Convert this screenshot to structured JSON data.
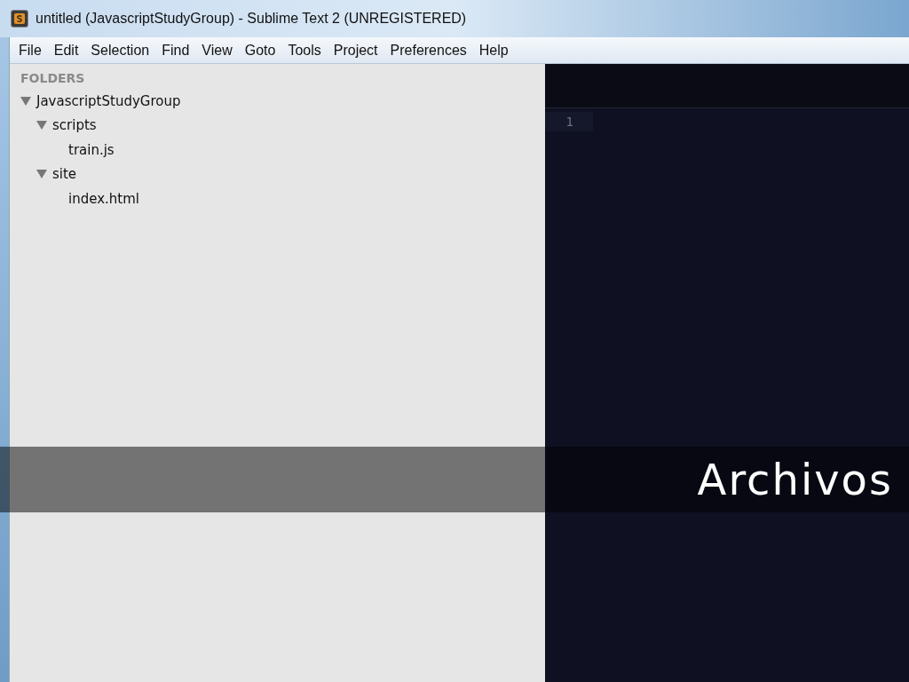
{
  "window": {
    "title": "untitled (JavascriptStudyGroup) - Sublime Text 2 (UNREGISTERED)"
  },
  "menu": [
    "File",
    "Edit",
    "Selection",
    "Find",
    "View",
    "Goto",
    "Tools",
    "Project",
    "Preferences",
    "Help"
  ],
  "sidebar": {
    "heading": "FOLDERS",
    "tree": [
      {
        "label": "JavascriptStudyGroup",
        "expanded": true,
        "children": [
          {
            "label": "scripts",
            "expanded": true,
            "children": [
              {
                "label": "train.js"
              }
            ]
          },
          {
            "label": "site",
            "expanded": true,
            "children": [
              {
                "label": "index.html"
              }
            ]
          }
        ]
      }
    ]
  },
  "editor": {
    "line_numbers": [
      "1"
    ]
  },
  "banner": {
    "text": "Archivos"
  }
}
